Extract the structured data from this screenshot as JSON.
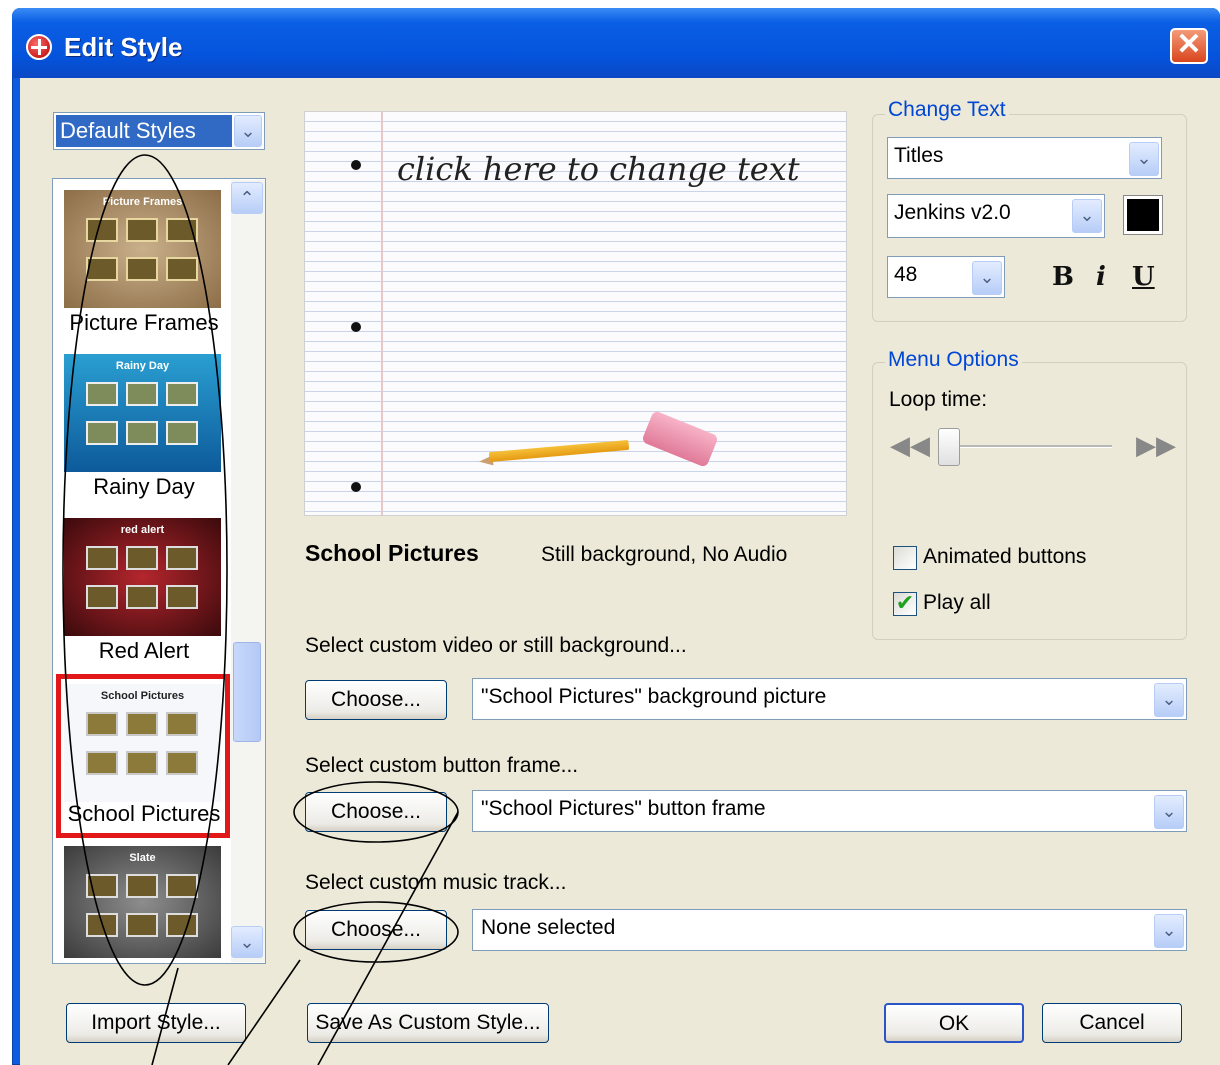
{
  "window": {
    "title": "Edit Style",
    "close_label": "✕"
  },
  "style_picker": {
    "selected": "Default Styles"
  },
  "styles": [
    {
      "label": "Picture Frames",
      "thumb_title": "Picture Frames"
    },
    {
      "label": "Rainy Day",
      "thumb_title": "Rainy Day"
    },
    {
      "label": "Red Alert",
      "thumb_title": "red alert"
    },
    {
      "label": "School Pictures",
      "thumb_title": "School Pictures"
    },
    {
      "label": "Slate",
      "thumb_title": "Slate"
    }
  ],
  "preview": {
    "text": "click here to change text"
  },
  "style_info": {
    "name": "School Pictures",
    "description": "Still background, No Audio"
  },
  "custom": {
    "background": {
      "label": "Select custom video or still background...",
      "button": "Choose...",
      "value": "\"School Pictures\" background picture"
    },
    "frame": {
      "label": "Select custom button frame...",
      "button": "Choose...",
      "value": "\"School Pictures\" button frame"
    },
    "music": {
      "label": "Select custom music track...",
      "button": "Choose...",
      "value": "None selected"
    }
  },
  "change_text": {
    "legend": "Change Text",
    "element": "Titles",
    "font": "Jenkins v2.0",
    "size": "48",
    "bold": "B",
    "italic": "i",
    "underline": "U",
    "color": "#000000"
  },
  "menu_options": {
    "legend": "Menu Options",
    "loop_label": "Loop time:",
    "animated_buttons": {
      "label": "Animated buttons",
      "checked": false
    },
    "play_all": {
      "label": "Play all",
      "checked": true
    }
  },
  "buttons": {
    "import": "Import Style...",
    "save_custom": "Save As Custom Style...",
    "ok": "OK",
    "cancel": "Cancel"
  },
  "colors": {
    "title_bar": "#0553dc",
    "accent": "#0046d5",
    "selection_border": "#e21818",
    "dialog_bg": "#ece9d8"
  }
}
